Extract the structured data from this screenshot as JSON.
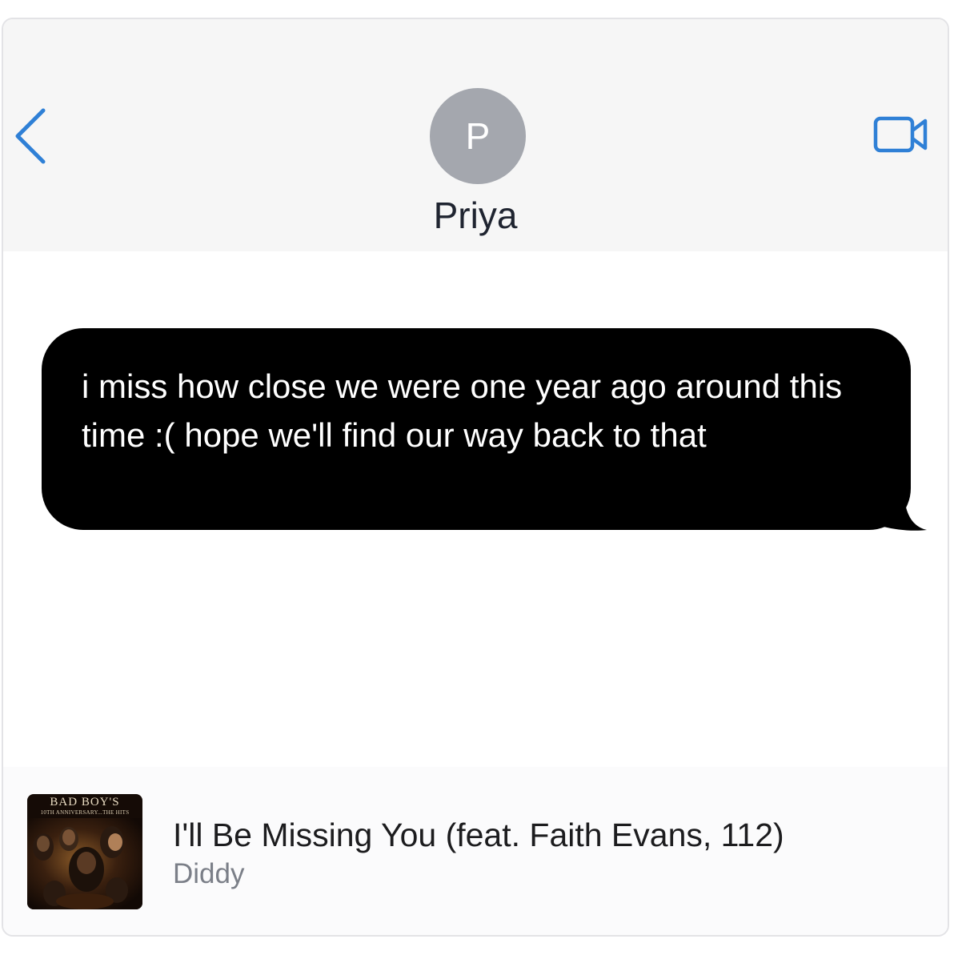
{
  "header": {
    "contact_initial": "P",
    "contact_name": "Priya",
    "accent_color": "#2f80d6",
    "back_icon": "chevron-left-icon",
    "video_icon": "video-camera-icon"
  },
  "messages": [
    {
      "direction": "sent",
      "text": "i miss how close we were one year ago around this time :( hope we'll find our way back to that",
      "bubble_color": "#000000"
    }
  ],
  "music_card": {
    "album_title": "BAD BOY'S",
    "album_subtitle": "10TH ANNIVERSARY...THE HITS",
    "song_title": "I'll Be Missing You (feat. Faith Evans, 112)",
    "artist": "Diddy"
  }
}
